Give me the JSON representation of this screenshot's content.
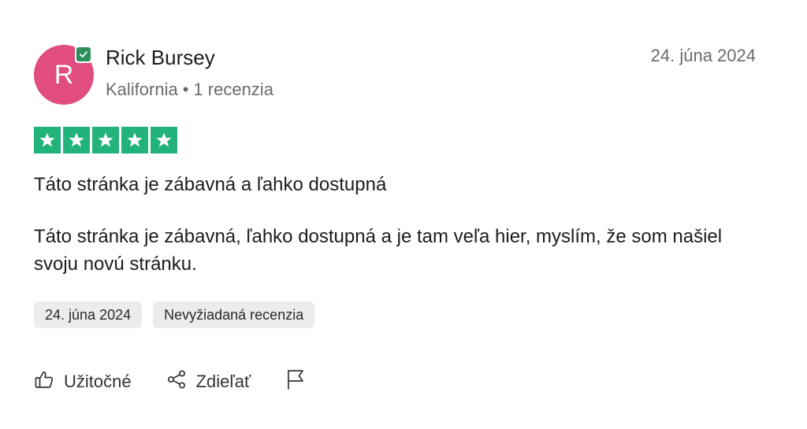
{
  "reviewer": {
    "initial": "R",
    "name": "Rick Bursey",
    "location": "Kalifornia",
    "separator": "•",
    "review_count": "1 recenzia",
    "avatar_color": "#e04d7e",
    "verified_icon": "verified-check-icon"
  },
  "review": {
    "date": "24. júna 2024",
    "rating": 5,
    "star_color": "#22b37a",
    "title": "Táto stránka je zábavná a ľahko dostupná",
    "body": "Táto stránka je zábavná, ľahko dostupná a je tam veľa hier, myslím, že som našiel svoju novú stránku."
  },
  "tags": {
    "date": "24. júna 2024",
    "type": "Nevyžiadaná recenzia"
  },
  "actions": {
    "helpful_label": "Užitočné",
    "share_label": "Zdieľať",
    "helpful_icon": "thumbs-up-icon",
    "share_icon": "share-icon",
    "report_icon": "flag-icon"
  }
}
